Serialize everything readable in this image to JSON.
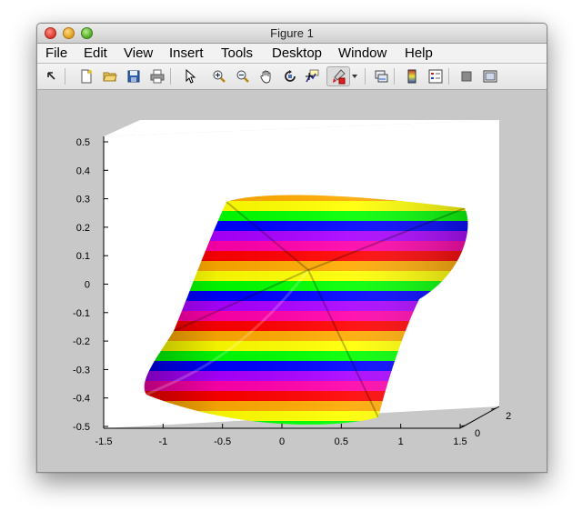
{
  "window": {
    "title": "Figure 1"
  },
  "menu": [
    "File",
    "Edit",
    "View",
    "Insert",
    "Tools",
    "Desktop",
    "Window",
    "Help"
  ],
  "toolbar": {
    "tools": [
      {
        "name": "edit-plot-icon"
      },
      {
        "name": "new-figure-icon"
      },
      {
        "name": "open-file-icon"
      },
      {
        "name": "save-figure-icon"
      },
      {
        "name": "print-figure-icon"
      },
      {
        "name": "pointer-icon"
      },
      {
        "name": "zoom-in-icon"
      },
      {
        "name": "zoom-out-icon"
      },
      {
        "name": "pan-hand-icon"
      },
      {
        "name": "rotate-3d-icon"
      },
      {
        "name": "data-cursor-icon"
      },
      {
        "name": "brush-icon"
      },
      {
        "name": "dropdown-arrow-icon"
      },
      {
        "name": "link-plot-icon"
      },
      {
        "name": "insert-colorbar-icon"
      },
      {
        "name": "insert-legend-icon"
      },
      {
        "name": "hide-plot-tools-icon"
      },
      {
        "name": "show-plot-tools-icon"
      }
    ]
  },
  "chart_data": {
    "type": "surface",
    "colormap": [
      "#ff0000",
      "#ffaa00",
      "#ffff00",
      "#00ff00",
      "#0000ff",
      "#aa00ff",
      "#ff00aa"
    ],
    "x_ticks": [
      "-1.5",
      "-1",
      "-0.5",
      "0",
      "0.5",
      "1",
      "1.5"
    ],
    "y_ticks": [
      "-0.5",
      "-0.4",
      "-0.3",
      "-0.2",
      "-0.1",
      "0",
      "0.1",
      "0.2",
      "0.3",
      "0.4",
      "0.5"
    ],
    "z_ticks": [
      "0",
      "2"
    ],
    "xlim": [
      -1.5,
      1.5
    ],
    "ylim": [
      -0.5,
      0.5
    ],
    "grid": false
  }
}
